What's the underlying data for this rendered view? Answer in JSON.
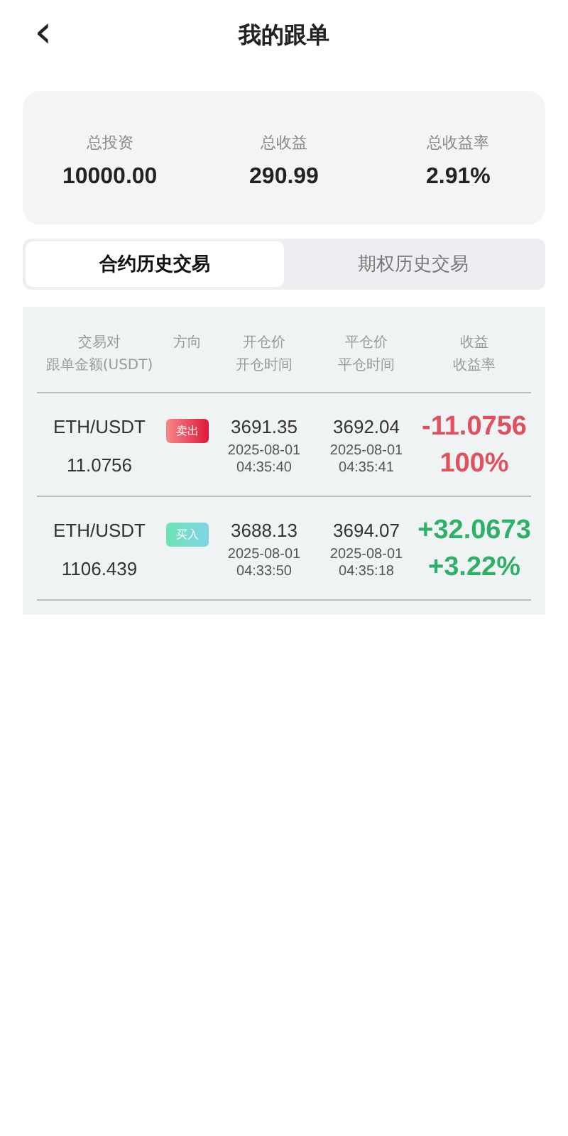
{
  "header": {
    "back": "‹",
    "title": "我的跟单"
  },
  "summary": [
    {
      "label": "总投资",
      "value": "10000.00"
    },
    {
      "label": "总收益",
      "value": "290.99"
    },
    {
      "label": "总收益率",
      "value": "2.91%"
    }
  ],
  "tabs": [
    {
      "label": "合约历史交易",
      "selected": true
    },
    {
      "label": "期权历史交易",
      "selected": false
    }
  ],
  "table": {
    "columns": [
      [
        "交易对",
        "跟单金额(USDT)"
      ],
      [
        "方向"
      ],
      [
        "开仓价",
        "开仓时间"
      ],
      [
        "平仓价",
        "平仓时间"
      ],
      [
        "收益",
        "收益率"
      ]
    ],
    "rows": [
      {
        "pair": "ETH/USDT",
        "amount": "11.0756",
        "direction": {
          "kind": "sell",
          "label": "卖出"
        },
        "open_price": "3691.35",
        "open_time": [
          "2025-08-01",
          "04:35:40"
        ],
        "close_price": "3692.04",
        "close_time": [
          "2025-08-01",
          "04:35:41"
        ],
        "kind": "loss",
        "profit": "-11.0756",
        "rate": "100%"
      },
      {
        "pair": "ETH/USDT",
        "amount": "1106.439",
        "direction": {
          "kind": "buy",
          "label": "买入"
        },
        "open_price": "3688.13",
        "open_time": [
          "2025-08-01",
          "04:33:50"
        ],
        "close_price": "3694.07",
        "close_time": [
          "2025-08-01",
          "04:35:18"
        ],
        "kind": "gain",
        "profit": "+32.0673",
        "rate": "+3.22%"
      }
    ]
  }
}
